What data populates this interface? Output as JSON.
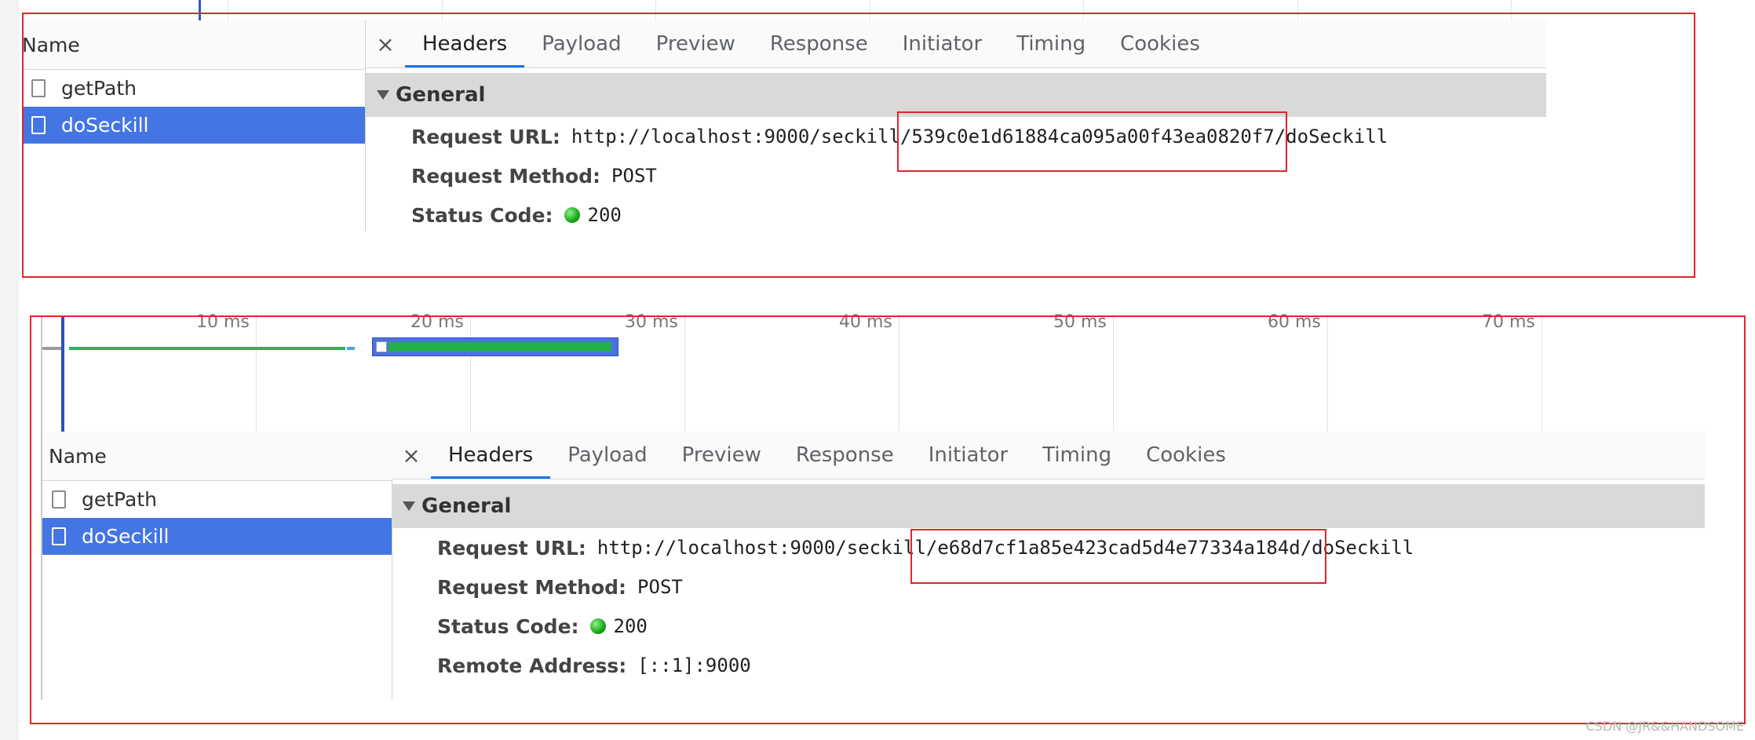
{
  "screenshots": [
    {
      "list_header": "Name",
      "requests": [
        {
          "name": "getPath",
          "selected": false
        },
        {
          "name": "doSeckill",
          "selected": true
        }
      ],
      "tabs": [
        "Headers",
        "Payload",
        "Preview",
        "Response",
        "Initiator",
        "Timing",
        "Cookies"
      ],
      "active_tab": "Headers",
      "close_glyph": "×",
      "section_title": "General",
      "fields": [
        {
          "key": "Request URL:",
          "value": "http://localhost:9000/seckill/539c0e1d61884ca095a00f43ea0820f7/doSeckill"
        },
        {
          "key": "Request Method:",
          "value": "POST"
        },
        {
          "key": "Status Code:",
          "value": "200",
          "status_icon": "green-dot-icon"
        }
      ]
    },
    {
      "list_header": "Name",
      "requests": [
        {
          "name": "getPath",
          "selected": false
        },
        {
          "name": "doSeckill",
          "selected": true
        }
      ],
      "tabs": [
        "Headers",
        "Payload",
        "Preview",
        "Response",
        "Initiator",
        "Timing",
        "Cookies"
      ],
      "active_tab": "Headers",
      "close_glyph": "×",
      "section_title": "General",
      "fields": [
        {
          "key": "Request URL:",
          "value": "http://localhost:9000/seckill/e68d7cf1a85e423cad5d4e77334a184d/doSeckill"
        },
        {
          "key": "Request Method:",
          "value": "POST"
        },
        {
          "key": "Status Code:",
          "value": "200",
          "status_icon": "green-dot-icon"
        },
        {
          "key": "Remote Address:",
          "value": "[::1]:9000"
        }
      ]
    }
  ],
  "timeline_ticks": [
    "10 ms",
    "20 ms",
    "30 ms",
    "40 ms",
    "50 ms",
    "60 ms",
    "70 ms"
  ],
  "watermark": "CSDN @JR&&HANDSOME",
  "colors": {
    "selected_row": "#4476e3",
    "active_tab_underline": "#1a73e8",
    "highlight_box": "#e0242f",
    "status_ok": "#15a715"
  }
}
